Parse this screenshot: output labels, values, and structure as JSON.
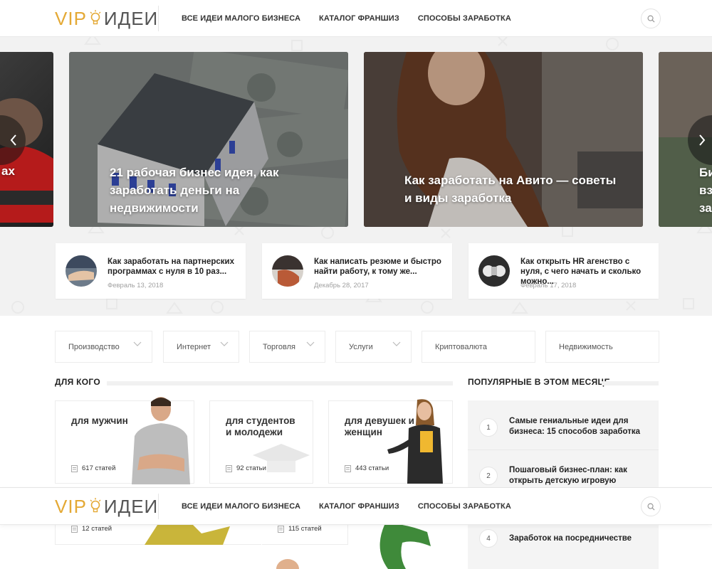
{
  "brand": {
    "vip": "VIP",
    "idei": "ИДЕИ",
    "accent": "#e4a935"
  },
  "nav": {
    "items": [
      {
        "label": "ВСЕ ИДЕИ МАЛОГО БИЗНЕСА"
      },
      {
        "label": "КАТАЛОГ ФРАНШИЗ"
      },
      {
        "label": "СПОСОБЫ ЗАРАБОТКА"
      }
    ]
  },
  "slider": {
    "slides": [
      {
        "caption": "ах"
      },
      {
        "caption": "21 рабочая бизнес идея, как заработать деньги на недвижимости"
      },
      {
        "caption": "Как заработать на Авито — советы и виды заработка"
      },
      {
        "caption": "Би\nвз\nза"
      }
    ]
  },
  "cards": [
    {
      "title": "Как заработать на партнерских программах с нуля в 10 раз...",
      "date": "Февраль 13, 2018"
    },
    {
      "title": "Как написать резюме и быстро найти работу, к тому же...",
      "date": "Декабрь 28, 2017"
    },
    {
      "title": "Как открыть HR агенство с нуля, с чего начать и сколько можно...",
      "date": "Февраль 17, 2018"
    }
  ],
  "filters": [
    {
      "label": "Производство",
      "dropdown": true
    },
    {
      "label": "Интернет",
      "dropdown": true
    },
    {
      "label": "Торговля",
      "dropdown": true
    },
    {
      "label": "Услуги",
      "dropdown": true
    },
    {
      "label": "Криптовалюта",
      "dropdown": false
    },
    {
      "label": "Недвижимость",
      "dropdown": false
    }
  ],
  "who": {
    "title": "ДЛЯ КОГО",
    "items": [
      {
        "title": "для мужчин",
        "count": "617 статей"
      },
      {
        "title": "для студентов и молодежи",
        "count": "92 статьи"
      },
      {
        "title": "для девушек и женщин",
        "count": "443 статьи"
      }
    ],
    "lower": [
      {
        "count": "12 статей"
      },
      {
        "count": "115 статей"
      }
    ]
  },
  "popular": {
    "title": "ПОПУЛЯРНЫЕ В ЭТОМ МЕСЯЦЕ",
    "items": [
      {
        "num": "1",
        "title": "Самые гениальные идеи для бизнеса: 15 способов заработка"
      },
      {
        "num": "2",
        "title": "Пошаговый бизнес-план: как открыть детскую игровую комнату"
      },
      {
        "num": "4",
        "title": "Заработок на посредничестве"
      }
    ]
  }
}
